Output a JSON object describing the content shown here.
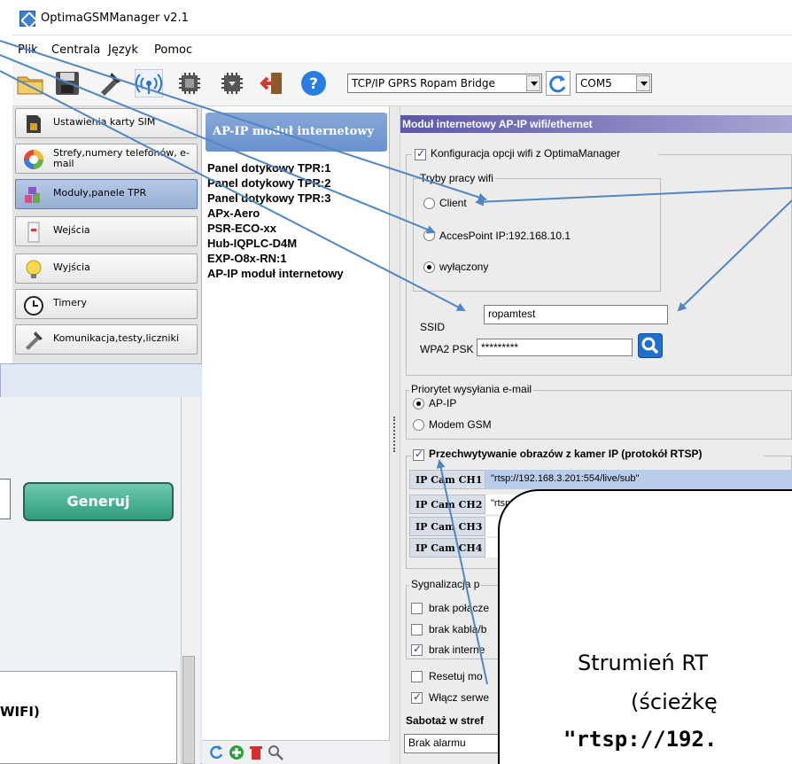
{
  "window": {
    "title": "OptimaGSMManager v2.1"
  },
  "menu": [
    "Plik",
    "Centrala",
    "Język",
    "Pomoc"
  ],
  "toolbar": {
    "connection_type": "TCP/IP GPRS Ropam Bridge",
    "port": "COM5",
    "icons": [
      "folder-icon",
      "save-icon",
      "tools-icon",
      "signal-icon",
      "chip-read-icon",
      "chip-write-icon",
      "exit-icon",
      "help-icon",
      "refresh-icon"
    ]
  },
  "sidebar": {
    "items": [
      {
        "label": "Ustawienia karty SIM",
        "icon": "sim-card-icon"
      },
      {
        "label": "Strefy,numery telefonów, e-mail",
        "icon": "zones-icon"
      },
      {
        "label": "Moduły,panele TPR",
        "icon": "modules-icon",
        "active": true
      },
      {
        "label": "Wejścia",
        "icon": "inputs-icon"
      },
      {
        "label": "Wyjścia",
        "icon": "outputs-icon"
      },
      {
        "label": "Timery",
        "icon": "clock-icon"
      },
      {
        "label": "Komunikacja,testy,liczniki",
        "icon": "tools-icon"
      }
    ]
  },
  "modules": {
    "header": "AP-IP moduł internetowy",
    "items": [
      "Panel dotykowy TPR:1",
      "Panel dotykowy TPR:2",
      "Panel dotykowy TPR:3",
      "APx-Aero",
      "PSR-ECO-xx",
      "Hub-IQPLC-D4M",
      "EXP-O8x-RN:1",
      "AP-IP moduł internetowy"
    ]
  },
  "panel": {
    "header": "Moduł internetowy AP-IP wifi/ethernet",
    "wifi_config": {
      "label": "Konfiguracja opcji wifi z OptimaManager",
      "checked": true,
      "modes_title": "Tryby pracy wifi",
      "modes": [
        {
          "label": "Client",
          "selected": false
        },
        {
          "label": "AccesPoint IP:192.168.10.1",
          "selected": false
        },
        {
          "label": "wyłączony",
          "selected": true
        }
      ],
      "ssid_label": "SSID",
      "ssid_value": "ropamtest",
      "psk_label": "WPA2 PSK",
      "psk_value": "*********"
    },
    "email_priority": {
      "title": "Priorytet wysyłania e-mail",
      "options": [
        {
          "label": "AP-IP",
          "selected": true
        },
        {
          "label": "Modem GSM",
          "selected": false
        }
      ]
    },
    "rtsp": {
      "label": "Przechwytywanie obrazów z kamer IP (protokół RTSP)",
      "checked": true,
      "cams": [
        {
          "name": "IP Cam CH1",
          "value": "\"rtsp://192.168.3.201:554/live/sub\""
        },
        {
          "name": "IP Cam CH2",
          "value": "\"rtsp:/"
        },
        {
          "name": "IP Cam CH3",
          "value": ""
        },
        {
          "name": "IP Cam CH4",
          "value": ""
        }
      ]
    },
    "signal": {
      "title": "Sygnalizacja p",
      "items": [
        {
          "label": "brak połącze",
          "checked": false
        },
        {
          "label": "brak kabla/b",
          "checked": false
        },
        {
          "label": "brak interne",
          "checked": true
        }
      ]
    },
    "extra": [
      {
        "label": "Resetuj mo",
        "checked": false
      },
      {
        "label": "Włącz serwe",
        "checked": true
      }
    ],
    "sabotage_label": "Sabotaż w stref",
    "sabotage_value": "Brak alarmu"
  },
  "dialog": {
    "button": "Generuj",
    "footer_text": "WIFI)"
  },
  "callout": {
    "line1": "Strumień RT",
    "line2": "(ścieżkę",
    "line3": "\"rtsp://192."
  },
  "colors": {
    "arrow": "#4f86c6",
    "panel_header": "#5c58a8",
    "module_header": "#7a9bd3",
    "generate_button": "#3fae8c"
  }
}
